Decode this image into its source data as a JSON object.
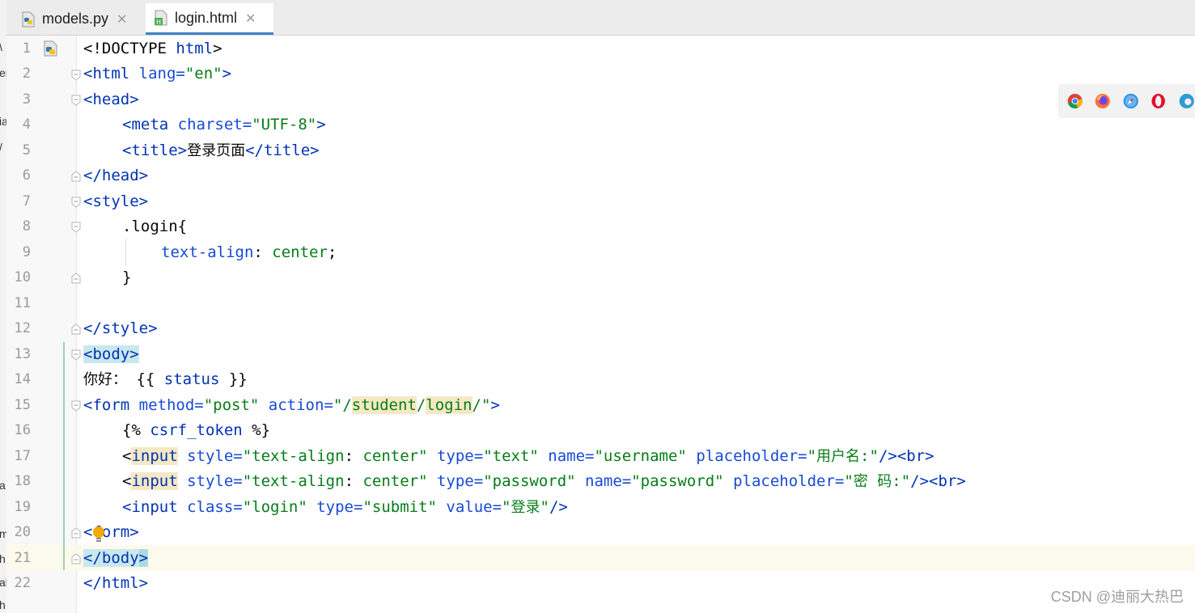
{
  "tabs": [
    {
      "label": "models.py",
      "icon": "python-file-icon",
      "active": false
    },
    {
      "label": "login.html",
      "icon": "html-file-icon",
      "active": true
    }
  ],
  "line_numbers": [
    "1",
    "2",
    "3",
    "4",
    "5",
    "6",
    "7",
    "8",
    "9",
    "10",
    "11",
    "12",
    "13",
    "14",
    "15",
    "16",
    "17",
    "18",
    "19",
    "20",
    "21",
    "22"
  ],
  "code": {
    "l1": {
      "a": "<!DOCTYPE ",
      "b": "html",
      "c": ">"
    },
    "l2": {
      "a": "<html ",
      "b": "lang=",
      "c": "\"en\"",
      "d": ">"
    },
    "l3": {
      "a": "<head>"
    },
    "l4": {
      "a": "<meta ",
      "b": "charset=",
      "c": "\"UTF-8\"",
      "d": ">"
    },
    "l5": {
      "a": "<title>",
      "b": "登录页面",
      "c": "</title>"
    },
    "l6": {
      "a": "</head>"
    },
    "l7": {
      "a": "<style>"
    },
    "l8": {
      "a": ".login{"
    },
    "l9": {
      "a": "text-align",
      "b": ": ",
      "c": "center",
      "d": ";"
    },
    "l10": {
      "a": "}"
    },
    "l12": {
      "a": "</style>"
    },
    "l13": {
      "a": "<body>"
    },
    "l14": {
      "a": "你好：",
      "b": " {{ ",
      "c": "status",
      "d": " }}"
    },
    "l15": {
      "a": "<form ",
      "b": "method=",
      "c": "\"post\" ",
      "d": "action=",
      "e": "\"/",
      "f": "student",
      "g": "/",
      "h": "login",
      "i": "/\"",
      "j": ">"
    },
    "l16": {
      "a": "{% ",
      "b": "csrf_token",
      "c": " %}"
    },
    "l17": {
      "a": "<",
      "b": "input",
      "c": " style=",
      "d": "\"text-align",
      "e": ": ",
      "f": "center\" ",
      "g": "type=",
      "h": "\"text\" ",
      "i": "name=",
      "j": "\"username\" ",
      "k": "placeholder=",
      "l": "\"",
      "m": "用户名",
      "n": ":\"",
      "o": "/><br>"
    },
    "l18": {
      "a": "<",
      "b": "input",
      "c": " style=",
      "d": "\"text-align",
      "e": ": ",
      "f": "center\" ",
      "g": "type=",
      "h": "\"password\" ",
      "i": "name=",
      "j": "\"password\" ",
      "k": "placeholder=",
      "l": "\"",
      "m": "密  码",
      "n": ":\"",
      "o": "/><br>"
    },
    "l19": {
      "a": "<input ",
      "b": "class=",
      "c": "\"login\" ",
      "d": "type=",
      "e": "\"submit\" ",
      "f": "value=",
      "g": "\"",
      "h": "登录",
      "i": "\"",
      "j": "/>"
    },
    "l20": {
      "a": "<",
      "b": "form",
      "c": ">"
    },
    "l21": {
      "a": "</body",
      "b": ">"
    },
    "l22": {
      "a": "</html>"
    }
  },
  "left_strip_chars": [
    "\\",
    "er",
    "ia",
    "/",
    "a",
    "m",
    "h",
    "al",
    "h"
  ],
  "browser_icons": [
    "chrome-icon",
    "firefox-icon",
    "safari-icon",
    "opera-icon",
    "edge-icon"
  ],
  "watermark": "CSDN @迪丽大热巴",
  "colors": {
    "tag": "#0033b3",
    "attribute": "#174ad4",
    "string": "#067d17",
    "line_number": "#9a9a9a",
    "active_tab_underline": "#4083c9"
  }
}
